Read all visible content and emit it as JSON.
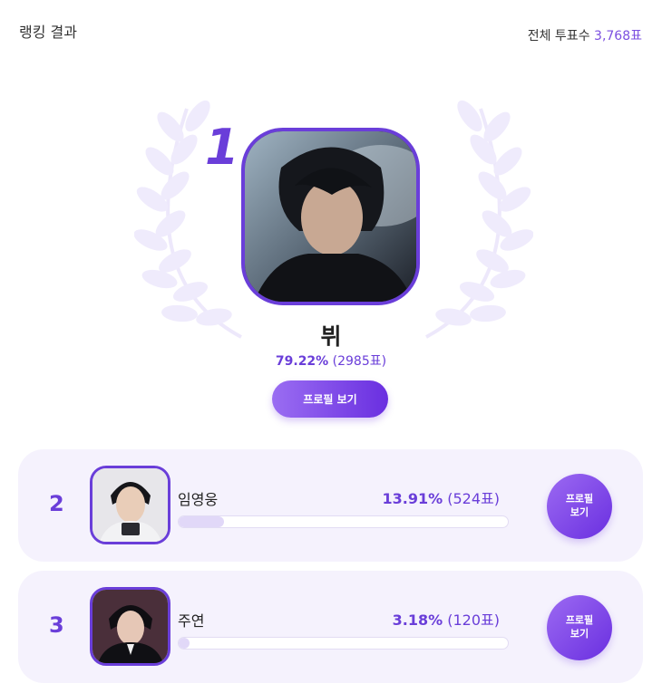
{
  "header": {
    "title": "랭킹 결과",
    "total_label": "전체 투표수",
    "total_value": "3,768표"
  },
  "winner": {
    "rank": "1",
    "name": "뷔",
    "percent": "79.22%",
    "votes": "(2985표)",
    "button_label": "프로필 보기",
    "share": 0.7922
  },
  "ranking": [
    {
      "rank": "2",
      "name": "임영웅",
      "percent": "13.91%",
      "votes": "(524표)",
      "button_label": "프로필\n보기",
      "share": 0.1391
    },
    {
      "rank": "3",
      "name": "주연",
      "percent": "3.18%",
      "votes": "(120표)",
      "button_label": "프로필\n보기",
      "share": 0.0318
    }
  ],
  "colors": {
    "accent": "#6a3ed9",
    "card_bg": "#f5f2fd",
    "bar_fill": "#e1d8f8"
  }
}
